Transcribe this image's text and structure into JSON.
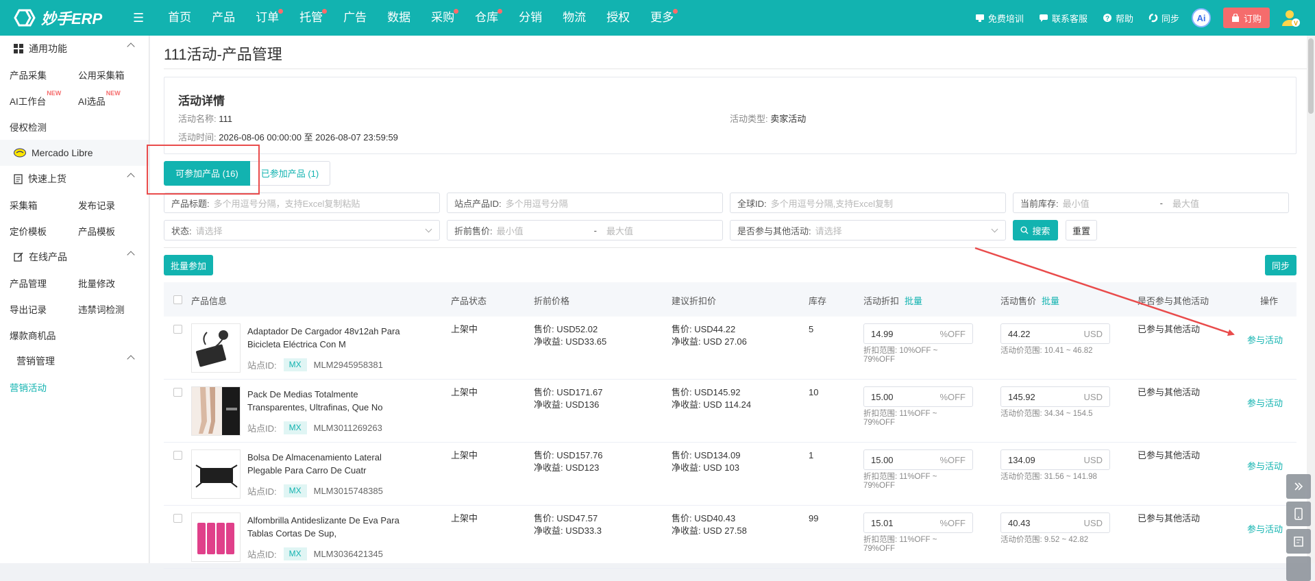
{
  "header": {
    "logo_text": "妙手ERP",
    "nav": [
      {
        "label": "首页",
        "dot": false
      },
      {
        "label": "产品",
        "dot": false
      },
      {
        "label": "订单",
        "dot": true
      },
      {
        "label": "托管",
        "dot": true
      },
      {
        "label": "广告",
        "dot": false
      },
      {
        "label": "数据",
        "dot": false
      },
      {
        "label": "采购",
        "dot": true
      },
      {
        "label": "仓库",
        "dot": true
      },
      {
        "label": "分销",
        "dot": false
      },
      {
        "label": "物流",
        "dot": false
      },
      {
        "label": "授权",
        "dot": false
      },
      {
        "label": "更多",
        "dot": true
      }
    ],
    "right": {
      "training": "免费培训",
      "support": "联系客服",
      "help": "帮助",
      "sync": "同步",
      "ai": "Ai",
      "order": "订购"
    }
  },
  "sidebar": {
    "common_group": "通用功能",
    "common_items": [
      "产品采集",
      "公用采集箱",
      "AI工作台",
      "AI选品",
      "侵权检测"
    ],
    "new_badge": "NEW",
    "platform": "Mercado Libre",
    "quick_group": "快速上货",
    "quick_items": [
      "采集箱",
      "发布记录",
      "定价模板",
      "产品模板"
    ],
    "online_group": "在线产品",
    "online_items": [
      "产品管理",
      "批量修改",
      "导出记录",
      "违禁词检测",
      "爆款商机品"
    ],
    "marketing_group": "营销管理",
    "marketing_items": [
      "营销活动"
    ]
  },
  "page": {
    "title": "111活动-产品管理",
    "detail_title": "活动详情",
    "name_label": "活动名称:",
    "name_value": "111",
    "type_label": "活动类型:",
    "type_value": "卖家活动",
    "time_label": "活动时间:",
    "time_value": "2026-08-06 00:00:00 至 2026-08-07 23:59:59"
  },
  "tabs": {
    "available": "可参加产品 (16)",
    "joined": "已参加产品 (1)"
  },
  "filters": {
    "title_label": "产品标题:",
    "title_ph": "多个用逗号分隔，支持Excel复制粘贴",
    "site_id_label": "站点产品ID:",
    "site_id_ph": "多个用逗号分隔",
    "global_id_label": "全球ID:",
    "global_id_ph": "多个用逗号分隔,支持Excel复制",
    "stock_label": "当前库存:",
    "min_ph": "最小值",
    "max_ph": "最大值",
    "range_sep": "-",
    "status_label": "状态:",
    "select_ph": "请选择",
    "price_label": "折前售价:",
    "other_label": "是否参与其他活动:",
    "search_btn": "搜索",
    "reset_btn": "重置"
  },
  "actions": {
    "batch_join": "批量参加",
    "sync": "同步"
  },
  "table": {
    "headers": {
      "info": "产品信息",
      "status": "产品状态",
      "orig_price": "折前价格",
      "suggest": "建议折扣价",
      "stock": "库存",
      "discount": "活动折扣",
      "act_price": "活动售价",
      "other": "是否参与其他活动",
      "op": "操作",
      "batch": "批量"
    },
    "site_id_label": "站点ID:",
    "op_link": "参与活动",
    "rows": [
      {
        "name": "Adaptador De Cargador 48v12ah Para Bicicleta Eléctrica Con M",
        "site": "MX",
        "id": "MLM2945958381",
        "status": "上架中",
        "price": "售价: USD52.02",
        "profit": "净收益: USD33.65",
        "s_price": "售价: USD44.22",
        "s_profit": "净收益: USD 27.06",
        "stock": "5",
        "discount": "14.99",
        "disc_suffix": "%OFF",
        "disc_range_1": "折扣范围: 10%OFF ~",
        "disc_range_2": "79%OFF",
        "act_price": "44.22",
        "currency": "USD",
        "price_range": "活动价范围: 10.41 ~ 46.82",
        "other": "已参与其他活动"
      },
      {
        "name": "Pack De Medias Totalmente Transparentes, Ultrafinas, Que No",
        "site": "MX",
        "id": "MLM3011269263",
        "status": "上架中",
        "price": "售价: USD171.67",
        "profit": "净收益: USD136",
        "s_price": "售价: USD145.92",
        "s_profit": "净收益: USD 114.24",
        "stock": "10",
        "discount": "15.00",
        "disc_suffix": "%OFF",
        "disc_range_1": "折扣范围: 11%OFF ~",
        "disc_range_2": "79%OFF",
        "act_price": "145.92",
        "currency": "USD",
        "price_range": "活动价范围: 34.34 ~ 154.5",
        "other": "已参与其他活动"
      },
      {
        "name": "Bolsa De Almacenamiento Lateral Plegable Para Carro De Cuatr",
        "site": "MX",
        "id": "MLM3015748385",
        "status": "上架中",
        "price": "售价: USD157.76",
        "profit": "净收益: USD123",
        "s_price": "售价: USD134.09",
        "s_profit": "净收益: USD 103",
        "stock": "1",
        "discount": "15.00",
        "disc_suffix": "%OFF",
        "disc_range_1": "折扣范围: 11%OFF ~",
        "disc_range_2": "79%OFF",
        "act_price": "134.09",
        "currency": "USD",
        "price_range": "活动价范围: 31.56 ~ 141.98",
        "other": "已参与其他活动"
      },
      {
        "name": "Alfombrilla Antideslizante De Eva Para Tablas Cortas De Sup,",
        "site": "MX",
        "id": "MLM3036421345",
        "status": "上架中",
        "price": "售价: USD47.57",
        "profit": "净收益: USD33.3",
        "s_price": "售价: USD40.43",
        "s_profit": "净收益: USD 27.58",
        "stock": "99",
        "discount": "15.01",
        "disc_suffix": "%OFF",
        "disc_range_1": "折扣范围: 11%OFF ~",
        "disc_range_2": "79%OFF",
        "act_price": "40.43",
        "currency": "USD",
        "price_range": "活动价范围: 9.52 ~ 42.82",
        "other": "已参与其他活动"
      }
    ]
  },
  "colors": {
    "brand": "#12b3b0",
    "annotation": "#e94b4b",
    "order_btn": "#f56c6c"
  }
}
